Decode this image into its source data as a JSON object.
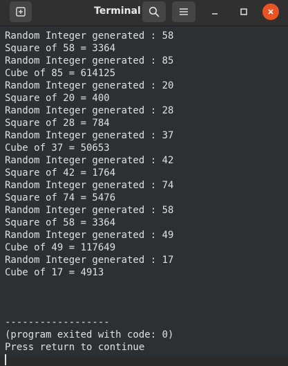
{
  "window": {
    "title": "Terminal"
  },
  "icons": {
    "new_tab": "new-tab-icon",
    "search": "search-icon",
    "menu": "hamburger-menu-icon",
    "minimize": "minimize-icon",
    "maximize": "maximize-icon",
    "close": "close-icon"
  },
  "colors": {
    "terminal_bg": "#2c3033",
    "terminal_fg": "#e0e0e0",
    "close_accent": "#e95420",
    "titlebar_bg": "#303030"
  },
  "terminal": {
    "lines": [
      "Random Integer generated : 58",
      "Square of 58 = 3364",
      "Random Integer generated : 85",
      "Cube of 85 = 614125",
      "Random Integer generated : 20",
      "Square of 20 = 400",
      "Random Integer generated : 28",
      "Square of 28 = 784",
      "Random Integer generated : 37",
      "Cube of 37 = 50653",
      "Random Integer generated : 42",
      "Square of 42 = 1764",
      "Random Integer generated : 74",
      "Square of 74 = 5476",
      "Random Integer generated : 58",
      "Square of 58 = 3364",
      "Random Integer generated : 49",
      "Cube of 49 = 117649",
      "Random Integer generated : 17",
      "Cube of 17 = 4913",
      "",
      "",
      "",
      "------------------",
      "(program exited with code: 0)",
      "Press return to continue"
    ]
  }
}
